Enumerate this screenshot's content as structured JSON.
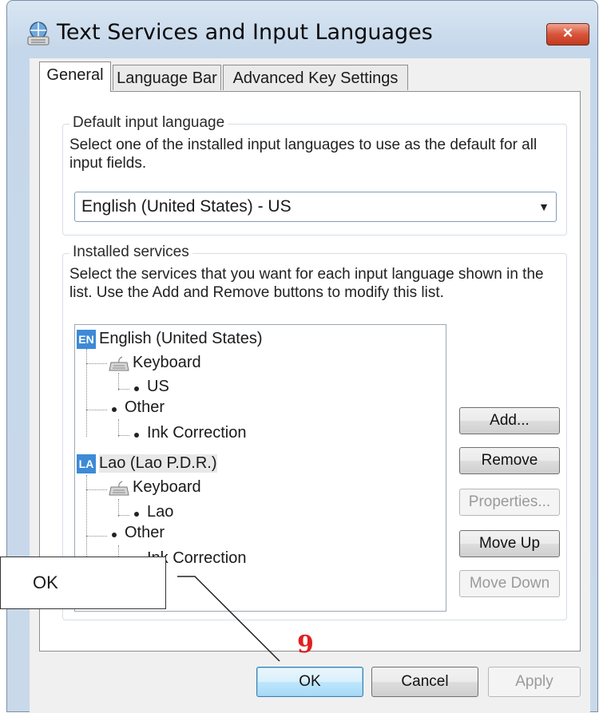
{
  "window": {
    "title": "Text Services and Input Languages",
    "close_label": "✕",
    "title_icon": "keyboard-globe-icon"
  },
  "tabs": [
    {
      "label": "General",
      "active": true
    },
    {
      "label": "Language Bar",
      "active": false
    },
    {
      "label": "Advanced Key Settings",
      "active": false
    }
  ],
  "default_input": {
    "legend": "Default input language",
    "description": "Select one of the installed input languages to use as the default for all input fields.",
    "selected": "English (United States) - US"
  },
  "installed": {
    "legend": "Installed services",
    "description": "Select the services that you want for each input language shown in the list. Use the Add and Remove buttons to modify this list.",
    "tree": {
      "en_badge": "EN",
      "en_label": "English (United States)",
      "en_keyboard": "Keyboard",
      "en_us": "US",
      "en_other": "Other",
      "en_ink": "Ink Correction",
      "la_badge": "LA",
      "la_label": "Lao (Lao P.D.R.)",
      "la_keyboard": "Keyboard",
      "la_lao": "Lao",
      "la_other": "Other",
      "la_ink": "Ink Correction"
    },
    "buttons": {
      "add": "Add...",
      "remove": "Remove",
      "properties": "Properties...",
      "move_up": "Move Up",
      "move_down": "Move Down"
    }
  },
  "footer": {
    "ok": "OK",
    "cancel": "Cancel",
    "apply": "Apply"
  },
  "annotation": {
    "callout_text": "OK",
    "step": "9",
    "step_color": "#e02020"
  }
}
